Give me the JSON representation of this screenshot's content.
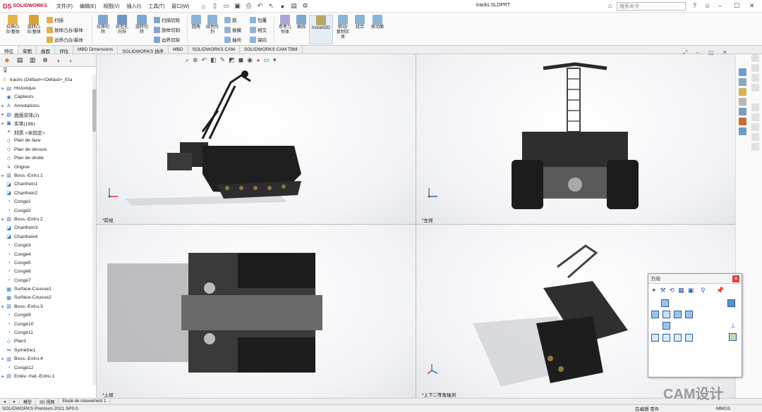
{
  "app": {
    "logo_prefix": "DS",
    "logo_name": "SOLIDWORKS",
    "document_title": "tracks.SLDPRT"
  },
  "menu": [
    "文件(F)",
    "编辑(E)",
    "视图(V)",
    "插入(I)",
    "工具(T)",
    "窗口(W)"
  ],
  "search": {
    "placeholder": "搜索命令"
  },
  "ribbon": {
    "extrude_boss": "拉伸凸\n台/基体",
    "revolve_boss": "旋转凸\n台/基体",
    "sweep": "扫描",
    "loft": "放样凸台/基体",
    "boundary_boss": "边界凸台/基体",
    "extrude_cut": "拉伸切\n除",
    "hole_wizard": "异型孔\n向导",
    "revolve_cut": "旋转切\n除",
    "swept_cut": "扫描切除",
    "lofted_cut": "放样切割",
    "boundary_cut": "边界切除",
    "fillet": "圆角",
    "linear_pattern": "线性阵\n列",
    "rib": "筋",
    "draft": "拔模",
    "shell": "抽壳",
    "wrap": "包覆",
    "intersect": "相交",
    "mirror": "镜向",
    "ref_geometry": "参考几\n何体",
    "curves": "曲线",
    "instant3d": "Instant3D",
    "move_copy": "移动/\n复制实\n体",
    "combine": "组合",
    "move_face": "移动面"
  },
  "tabs": [
    "特征",
    "草图",
    "曲面",
    "评估",
    "MBD Dimensions",
    "SOLIDWORKS 插件",
    "MBD",
    "SOLIDWORKS CAM",
    "SOLIDWORKS CAM TBM"
  ],
  "tree": {
    "root": "tracks (Défaut<<Défaut>_Eta",
    "items": [
      {
        "label": "Historique",
        "icon": "folder-icon",
        "expand": "▸"
      },
      {
        "label": "Capteurs",
        "icon": "sensor-icon",
        "expand": ""
      },
      {
        "label": "Annotations",
        "icon": "annotation-icon",
        "expand": "▸"
      },
      {
        "label": "曲面实体(2)",
        "icon": "surface-body-icon",
        "expand": "▸"
      },
      {
        "label": "实体(196)",
        "icon": "solid-body-icon",
        "expand": "▸"
      },
      {
        "label": "材质 <未指定>",
        "icon": "material-icon",
        "expand": ""
      },
      {
        "label": "Plan de face",
        "icon": "plane-icon",
        "expand": ""
      },
      {
        "label": "Plan de dessus",
        "icon": "plane-icon",
        "expand": ""
      },
      {
        "label": "Plan de droite",
        "icon": "plane-icon",
        "expand": ""
      },
      {
        "label": "Origine",
        "icon": "origin-icon",
        "expand": ""
      },
      {
        "label": "Boss.-Extru.1",
        "icon": "extrude-icon",
        "expand": "▸"
      },
      {
        "label": "Chanfrein1",
        "icon": "chamfer-icon",
        "expand": ""
      },
      {
        "label": "Chanfrein2",
        "icon": "chamfer-icon",
        "expand": ""
      },
      {
        "label": "Congé1",
        "icon": "fillet-icon",
        "expand": ""
      },
      {
        "label": "Congé2",
        "icon": "fillet-icon",
        "expand": ""
      },
      {
        "label": "Boss.-Extru.2",
        "icon": "extrude-icon",
        "expand": "▸"
      },
      {
        "label": "Chanfrein3",
        "icon": "chamfer-icon",
        "expand": ""
      },
      {
        "label": "Chanfrein4",
        "icon": "chamfer-icon",
        "expand": ""
      },
      {
        "label": "Congé3",
        "icon": "fillet-icon",
        "expand": ""
      },
      {
        "label": "Congé4",
        "icon": "fillet-icon",
        "expand": ""
      },
      {
        "label": "Congé5",
        "icon": "fillet-icon",
        "expand": ""
      },
      {
        "label": "Congé6",
        "icon": "fillet-icon",
        "expand": ""
      },
      {
        "label": "Congé7",
        "icon": "fillet-icon",
        "expand": ""
      },
      {
        "label": "Surface-Cousue1",
        "icon": "knit-icon",
        "expand": ""
      },
      {
        "label": "Surface-Cousue2",
        "icon": "knit-icon",
        "expand": ""
      },
      {
        "label": "Boss.-Extru.3",
        "icon": "extrude-icon",
        "expand": "▸"
      },
      {
        "label": "Congé9",
        "icon": "fillet-icon",
        "expand": ""
      },
      {
        "label": "Congé10",
        "icon": "fillet-icon",
        "expand": ""
      },
      {
        "label": "Congé11",
        "icon": "fillet-icon",
        "expand": ""
      },
      {
        "label": "Plan1",
        "icon": "plane-icon",
        "expand": ""
      },
      {
        "label": "Symétrie1",
        "icon": "mirror-icon",
        "expand": ""
      },
      {
        "label": "Boss.-Extru.4",
        "icon": "extrude-icon",
        "expand": "▸"
      },
      {
        "label": "Congé12",
        "icon": "fillet-icon",
        "expand": ""
      },
      {
        "label": "Enlév. mat.-Extru.1",
        "icon": "cut-icon",
        "expand": "▸"
      }
    ]
  },
  "views": {
    "front": "*前视",
    "left": "*左视",
    "top": "*上视",
    "iso": "*上下二等角轴测"
  },
  "orientation": {
    "title": "方向"
  },
  "bottom_tabs": [
    "模型",
    "3D 视图",
    "Etude de mouvement 1"
  ],
  "status": {
    "product": "SOLIDWORKS Premium 2021 SP0.0",
    "state": "在编辑 零件",
    "units": "MMGS"
  },
  "watermark": "CAM设计",
  "colors": {
    "accent": "#c8102e",
    "viewport_bg": "#f2f3f6",
    "model": "#2a2a2a",
    "cube_blue": "#9cc4ea"
  }
}
